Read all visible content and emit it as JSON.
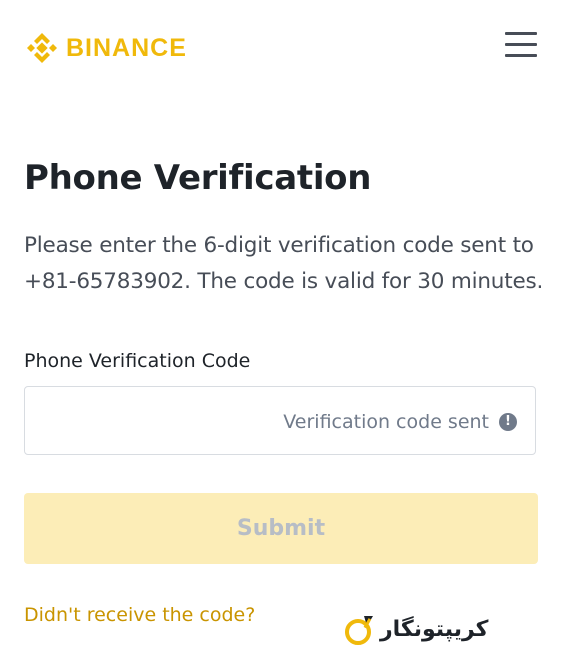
{
  "brand": {
    "name": "BINANCE",
    "color": "#f0b90b"
  },
  "header": {
    "menu_icon": "hamburger-menu-icon"
  },
  "main": {
    "title": "Phone Verification",
    "description": "Please enter the 6-digit verification code sent to +81-65783902. The code is valid for 30 minutes.",
    "field": {
      "label": "Phone Verification Code",
      "value": "",
      "status": "Verification code sent",
      "status_icon": "info-icon"
    },
    "submit_label": "Submit",
    "resend_link": "Didn't receive the code?"
  },
  "watermark": {
    "text": "کریپتونگار"
  }
}
